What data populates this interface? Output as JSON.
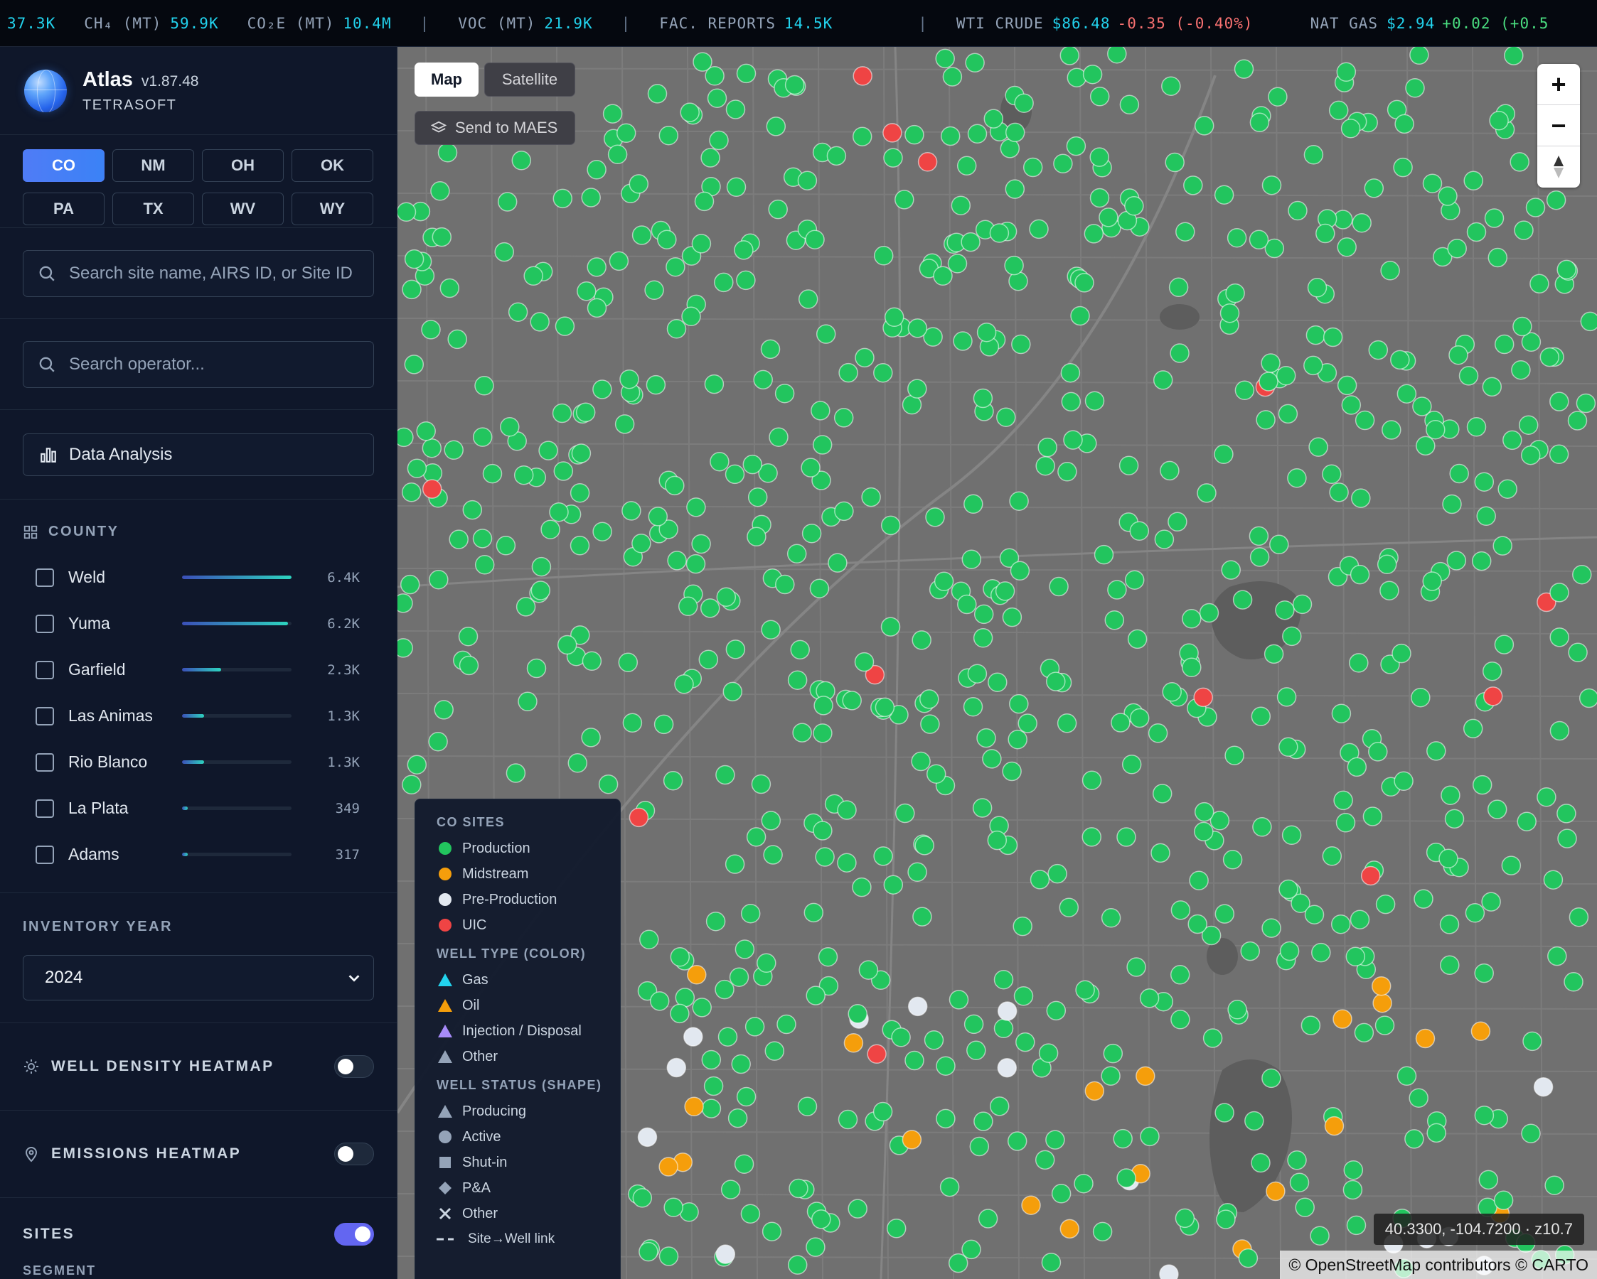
{
  "ticker": [
    {
      "label": "",
      "value": "37.3K"
    },
    {
      "label": "CH₄ (MT)",
      "value": "59.9K"
    },
    {
      "label": "CO₂E (MT)",
      "value": "10.4M"
    },
    {
      "sep": "|"
    },
    {
      "label": "VOC (MT)",
      "value": "21.9K"
    },
    {
      "sep": "|"
    },
    {
      "label": "FAC. REPORTS",
      "value": "14.5K"
    },
    {
      "sep": "|"
    },
    {
      "label": "WTI CRUDE",
      "value": "$86.48",
      "change": "-0.35 (-0.40%)",
      "dir": "neg"
    },
    {
      "label": "NAT GAS",
      "value": "$2.94",
      "change": "+0.02 (+0.5",
      "dir": "pos"
    }
  ],
  "brand": {
    "name": "Atlas",
    "version": "v1.87.48",
    "company": "TETRASOFT"
  },
  "states": [
    {
      "code": "CO",
      "active": true
    },
    {
      "code": "NM",
      "active": false
    },
    {
      "code": "OH",
      "active": false
    },
    {
      "code": "OK",
      "active": false
    },
    {
      "code": "PA",
      "active": false
    },
    {
      "code": "TX",
      "active": false
    },
    {
      "code": "WV",
      "active": false
    },
    {
      "code": "WY",
      "active": false
    }
  ],
  "site_search": {
    "placeholder": "Search site name, AIRS ID, or Site ID"
  },
  "operator_search": {
    "placeholder": "Search operator..."
  },
  "analysis": {
    "label": "Data Analysis"
  },
  "county": {
    "title": "COUNTY",
    "items": [
      {
        "name": "Weld",
        "value": "6.4K",
        "fraction": 1.0
      },
      {
        "name": "Yuma",
        "value": "6.2K",
        "fraction": 0.97
      },
      {
        "name": "Garfield",
        "value": "2.3K",
        "fraction": 0.36
      },
      {
        "name": "Las Animas",
        "value": "1.3K",
        "fraction": 0.2
      },
      {
        "name": "Rio Blanco",
        "value": "1.3K",
        "fraction": 0.2
      },
      {
        "name": "La Plata",
        "value": "349",
        "fraction": 0.05
      },
      {
        "name": "Adams",
        "value": "317",
        "fraction": 0.05
      }
    ]
  },
  "inventory": {
    "title": "INVENTORY YEAR",
    "selected": "2024"
  },
  "toggles": {
    "well_density": {
      "label": "WELL DENSITY HEATMAP",
      "on": false
    },
    "emissions": {
      "label": "EMISSIONS HEATMAP",
      "on": false
    },
    "sites": {
      "label": "SITES",
      "on": true
    },
    "segment": {
      "label": "SEGMENT"
    }
  },
  "map": {
    "tabs": [
      {
        "label": "Map",
        "active": true
      },
      {
        "label": "Satellite",
        "active": false
      }
    ],
    "send_label": "Send to MAES",
    "zoom_in": "+",
    "zoom_out": "−",
    "coords": "40.3300, -104.7200 · z10.7",
    "attribution": "© OpenStreetMap contributors © CARTO"
  },
  "legend": {
    "sites_title": "CO SITES",
    "sites": [
      {
        "label": "Production",
        "color": "#22c55e"
      },
      {
        "label": "Midstream",
        "color": "#f59e0b"
      },
      {
        "label": "Pre-Production",
        "color": "#e2e8f0"
      },
      {
        "label": "UIC",
        "color": "#ef4444"
      }
    ],
    "type_title": "WELL TYPE (COLOR)",
    "types": [
      {
        "label": "Gas",
        "color": "#22d3ee"
      },
      {
        "label": "Oil",
        "color": "#f59e0b"
      },
      {
        "label": "Injection / Disposal",
        "color": "#a78bfa"
      },
      {
        "label": "Other",
        "color": "#94a3b8"
      }
    ],
    "status_title": "WELL STATUS (SHAPE)",
    "statuses": [
      {
        "label": "Producing",
        "shape": "triangle"
      },
      {
        "label": "Active",
        "shape": "circle"
      },
      {
        "label": "Shut-in",
        "shape": "square"
      },
      {
        "label": "P&A",
        "shape": "diamond"
      },
      {
        "label": "Other",
        "shape": "x"
      }
    ],
    "link_label": "Site→Well link"
  },
  "colors": {
    "accent": "#4f7cf6",
    "production": "#22c55e",
    "midstream": "#f59e0b",
    "preprod": "#e2e8f0",
    "uic": "#ef4444"
  }
}
